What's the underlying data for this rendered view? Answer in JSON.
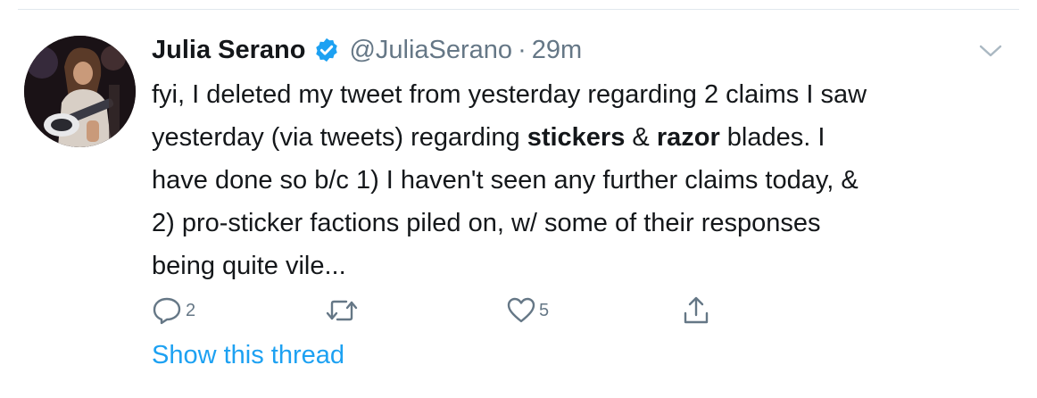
{
  "tweet": {
    "author_name": "Julia Serano",
    "handle": "@JuliaSerano",
    "separator": "·",
    "timestamp": "29m",
    "text_line1": "fyi, I deleted my tweet from yesterday regarding 2 claims I saw",
    "text_line2_pre": "yesterday (via tweets) regarding ",
    "text_line2_bold1": "stickers",
    "text_line2_mid": " & ",
    "text_line2_bold2": "razor",
    "text_line2_post": " blades. I",
    "text_line3": "have done so b/c 1) I haven't seen any further claims today, &",
    "text_line4": "2) pro-sticker factions piled on, w/ some of their responses",
    "text_line5": "being quite vile..."
  },
  "actions": {
    "reply_count": "2",
    "like_count": "5",
    "reply_icon": "reply-icon",
    "retweet_icon": "retweet-icon",
    "like_icon": "heart-icon",
    "share_icon": "share-icon"
  },
  "thread": {
    "show_thread_label": "Show this thread"
  },
  "colors": {
    "accent": "#1da1f2",
    "text": "#14171a",
    "muted": "#657786",
    "divider": "#e1e8ed"
  }
}
